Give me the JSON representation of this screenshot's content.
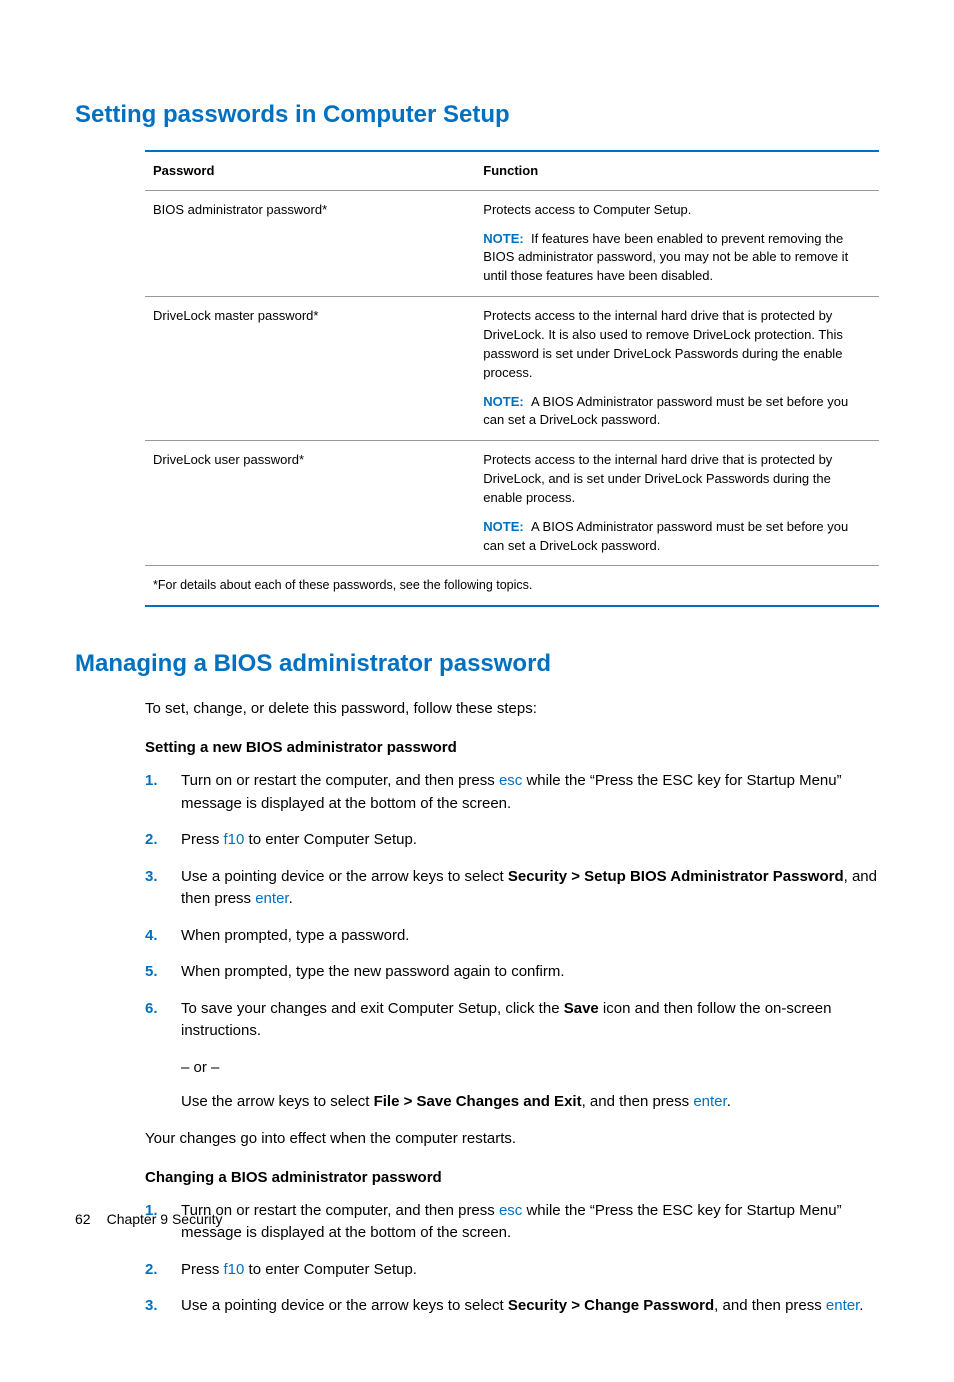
{
  "heading1": "Setting passwords in Computer Setup",
  "table": {
    "header": {
      "col1": "Password",
      "col2": "Function"
    },
    "rows": [
      {
        "name": "BIOS administrator password*",
        "desc": "Protects access to Computer Setup.",
        "note_label": "NOTE:",
        "note": "If features have been enabled to prevent removing the BIOS administrator password, you may not be able to remove it until those features have been disabled."
      },
      {
        "name": "DriveLock master password*",
        "desc": "Protects access to the internal hard drive that is protected by DriveLock. It is also used to remove DriveLock protection. This password is set under DriveLock Passwords during the enable process.",
        "note_label": "NOTE:",
        "note": "A BIOS Administrator password must be set before you can set a DriveLock password."
      },
      {
        "name": "DriveLock user password*",
        "desc": "Protects access to the internal hard drive that is protected by DriveLock, and is set under DriveLock Passwords during the enable process.",
        "note_label": "NOTE:",
        "note": "A BIOS Administrator password must be set before you can set a DriveLock password."
      }
    ],
    "footnote": "*For details about each of these passwords, see the following topics."
  },
  "heading2": "Managing a BIOS administrator password",
  "intro": "To set, change, or delete this password, follow these steps:",
  "subA": "Setting a new BIOS administrator password",
  "stepsA": {
    "s1a": "Turn on or restart the computer, and then press ",
    "s1key": "esc",
    "s1b": " while the “Press the ESC key for Startup Menu” message is displayed at the bottom of the screen.",
    "s2a": "Press ",
    "s2key": "f10",
    "s2b": " to enter Computer Setup.",
    "s3a": "Use a pointing device or the arrow keys to select ",
    "s3bold": "Security > Setup BIOS Administrator Password",
    "s3b": ", and then press ",
    "s3key": "enter",
    "s3c": ".",
    "s4": "When prompted, type a password.",
    "s5": "When prompted, type the new password again to confirm.",
    "s6a": "To save your changes and exit Computer Setup, click the ",
    "s6bold": "Save",
    "s6b": " icon and then follow the on-screen instructions.",
    "or": "– or –",
    "s6c": "Use the arrow keys to select ",
    "s6bold2": "File > Save Changes and Exit",
    "s6d": ", and then press ",
    "s6key": "enter",
    "s6e": "."
  },
  "effect": "Your changes go into effect when the computer restarts.",
  "subB": "Changing a BIOS administrator password",
  "stepsB": {
    "s1a": "Turn on or restart the computer, and then press ",
    "s1key": "esc",
    "s1b": " while the “Press the ESC key for Startup Menu” message is displayed at the bottom of the screen.",
    "s2a": "Press ",
    "s2key": "f10",
    "s2b": " to enter Computer Setup.",
    "s3a": "Use a pointing device or the arrow keys to select ",
    "s3bold": "Security > Change Password",
    "s3b": ", and then press ",
    "s3key": "enter",
    "s3c": "."
  },
  "footer": {
    "page": "62",
    "chapter": "Chapter 9   Security"
  }
}
